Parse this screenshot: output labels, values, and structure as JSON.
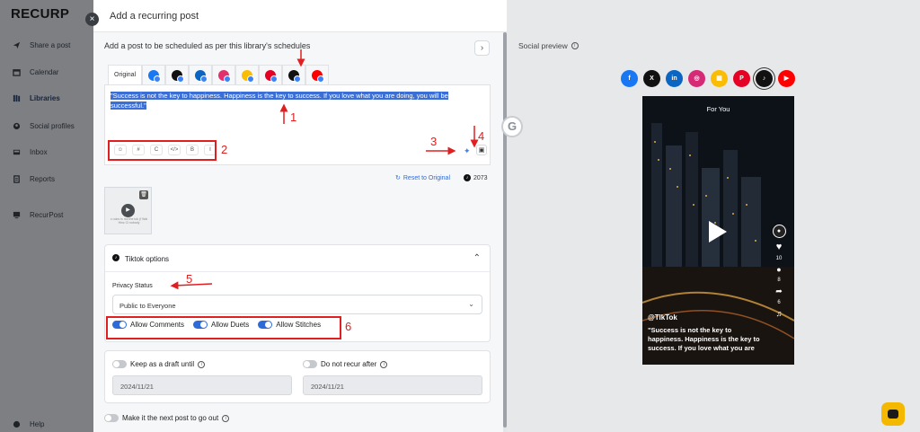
{
  "sidebar": {
    "brand": "RECURP",
    "items": [
      {
        "label": "Share a post",
        "icon": "send-icon"
      },
      {
        "label": "Calendar",
        "icon": "calendar-icon"
      },
      {
        "label": "Libraries",
        "icon": "library-icon",
        "active": true
      },
      {
        "label": "Social profiles",
        "icon": "profile-icon"
      },
      {
        "label": "Inbox",
        "icon": "inbox-icon"
      },
      {
        "label": "Reports",
        "icon": "reports-icon"
      },
      {
        "label": "RecurPost",
        "icon": "monitor-icon"
      },
      {
        "label": "Help",
        "icon": "help-icon"
      }
    ]
  },
  "modal": {
    "title": "Add a recurring post",
    "close_label": "×",
    "subtitle": "Add a post to be scheduled as per this library's schedules",
    "next_label": "›",
    "tabs": {
      "original_label": "Original",
      "icons": [
        {
          "name": "facebook-tab-icon",
          "color": "#1877f2"
        },
        {
          "name": "x-tab-icon",
          "color": "#111111"
        },
        {
          "name": "linkedin-tab-icon",
          "color": "#0a66c2"
        },
        {
          "name": "instagram-tab-icon",
          "color": "#e1306c"
        },
        {
          "name": "google-business-tab-icon",
          "color": "#fbbc04"
        },
        {
          "name": "pinterest-tab-icon",
          "color": "#e60023"
        },
        {
          "name": "tiktok-tab-icon",
          "color": "#111111"
        },
        {
          "name": "youtube-tab-icon",
          "color": "#ff0000"
        }
      ]
    },
    "editor": {
      "text": "\"Success is not the key to happiness. Happiness is the key to success. If you love what you are doing, you will be successful.\"",
      "format_buttons": [
        "☺",
        "#",
        "C",
        "</>",
        "B",
        "I"
      ],
      "ai_icon": "✦",
      "media_icon": "▣"
    },
    "reset_label": "Reset to Original",
    "char_count": "2073",
    "media_caption": "c rolov is not the tok (f Wai Hinc Cl nobody",
    "tiktok": {
      "title": "Tiktok options",
      "privacy_label": "Privacy Status",
      "privacy_value": "Public to Everyone",
      "toggles": [
        {
          "label": "Allow Comments",
          "on": true
        },
        {
          "label": "Allow Duets",
          "on": true
        },
        {
          "label": "Allow Stitches",
          "on": true
        }
      ]
    },
    "draft": {
      "keep_draft_label": "Keep as a draft until",
      "keep_draft_date": "2024/11/21",
      "no_recur_label": "Do not recur after",
      "no_recur_date": "2024/11/21"
    },
    "next_post_label": "Make it the next post to go out"
  },
  "preview": {
    "title": "Social preview",
    "networks": [
      {
        "name": "facebook",
        "glyph": "f",
        "color": "#1877f2"
      },
      {
        "name": "x",
        "glyph": "X",
        "color": "#111111"
      },
      {
        "name": "linkedin",
        "glyph": "in",
        "color": "#0a66c2"
      },
      {
        "name": "instagram",
        "glyph": "◎",
        "color": "#d62976"
      },
      {
        "name": "google-business",
        "glyph": "▦",
        "color": "#fbbc04"
      },
      {
        "name": "pinterest",
        "glyph": "P",
        "color": "#e60023"
      },
      {
        "name": "tiktok",
        "glyph": "♪",
        "color": "#111111",
        "active": true
      },
      {
        "name": "youtube",
        "glyph": "▶",
        "color": "#ff0000"
      }
    ],
    "for_you": "For You",
    "likes": "10",
    "comments": "8",
    "shares": "6",
    "username": "@TikTok",
    "caption": "\"Success is not the key to happiness. Happiness is the key to success. If you love what you are"
  },
  "annotations": [
    "1",
    "2",
    "3",
    "4",
    "5",
    "6"
  ],
  "colors": {
    "accent": "#2e6bd8",
    "annotation": "#e02020",
    "chat": "#f5b800"
  }
}
